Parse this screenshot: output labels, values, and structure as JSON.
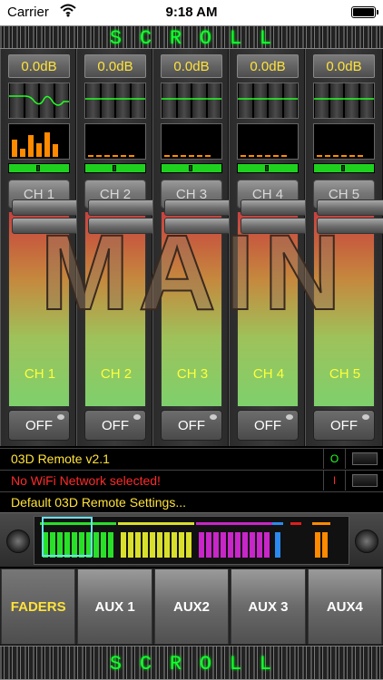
{
  "status_bar": {
    "carrier": "Carrier",
    "time": "9:18 AM"
  },
  "scroll_top": [
    "S",
    "C",
    "R",
    "O",
    "L",
    "L"
  ],
  "scroll_bottom": [
    "S",
    "C",
    "R",
    "O",
    "L",
    "L"
  ],
  "channels": [
    {
      "db": "0.0dB",
      "label": "CH 1",
      "fader_label": "CH 1",
      "off": "OFF",
      "meter": [
        0.55,
        0.25,
        0.7,
        0.45,
        0.8,
        0.4
      ],
      "pan": 0.5
    },
    {
      "db": "0.0dB",
      "label": "CH 2",
      "fader_label": "CH 2",
      "off": "OFF",
      "meter": [
        0.05,
        0.05,
        0.05,
        0.05,
        0.05,
        0.05
      ],
      "pan": 0.5
    },
    {
      "db": "0.0dB",
      "label": "CH 3",
      "fader_label": "CH 3",
      "off": "OFF",
      "meter": [
        0.05,
        0.05,
        0.05,
        0.05,
        0.05,
        0.05
      ],
      "pan": 0.5
    },
    {
      "db": "0.0dB",
      "label": "CH 4",
      "fader_label": "CH 4",
      "off": "OFF",
      "meter": [
        0.05,
        0.05,
        0.05,
        0.05,
        0.05,
        0.05
      ],
      "pan": 0.5
    },
    {
      "db": "0.0dB",
      "label": "CH 5",
      "fader_label": "CH 5",
      "off": "OFF",
      "meter": [
        0.05,
        0.05,
        0.05,
        0.05,
        0.05,
        0.05
      ],
      "pan": 0.5
    }
  ],
  "overlay_text": "MAIN",
  "info": {
    "version": "03D Remote v2.1",
    "version_indicator": "O",
    "wifi": "No WiFi Network selected!",
    "wifi_indicator": "I",
    "settings": "Default 03D Remote Settings..."
  },
  "tabs": [
    "FADERS",
    "AUX 1",
    "AUX2",
    "AUX 3",
    "AUX4"
  ],
  "active_tab": "FADERS",
  "colors": {
    "accent_yellow": "#ffe23a",
    "scroll_green": "#11ff33",
    "info_red": "#ff2a2a",
    "info_yellow": "#ffe23a",
    "mini_groups": [
      "#29e029",
      "#d9e02b",
      "#c826c8",
      "#2b8af0",
      "#e01e1e",
      "#ff8a00"
    ]
  }
}
